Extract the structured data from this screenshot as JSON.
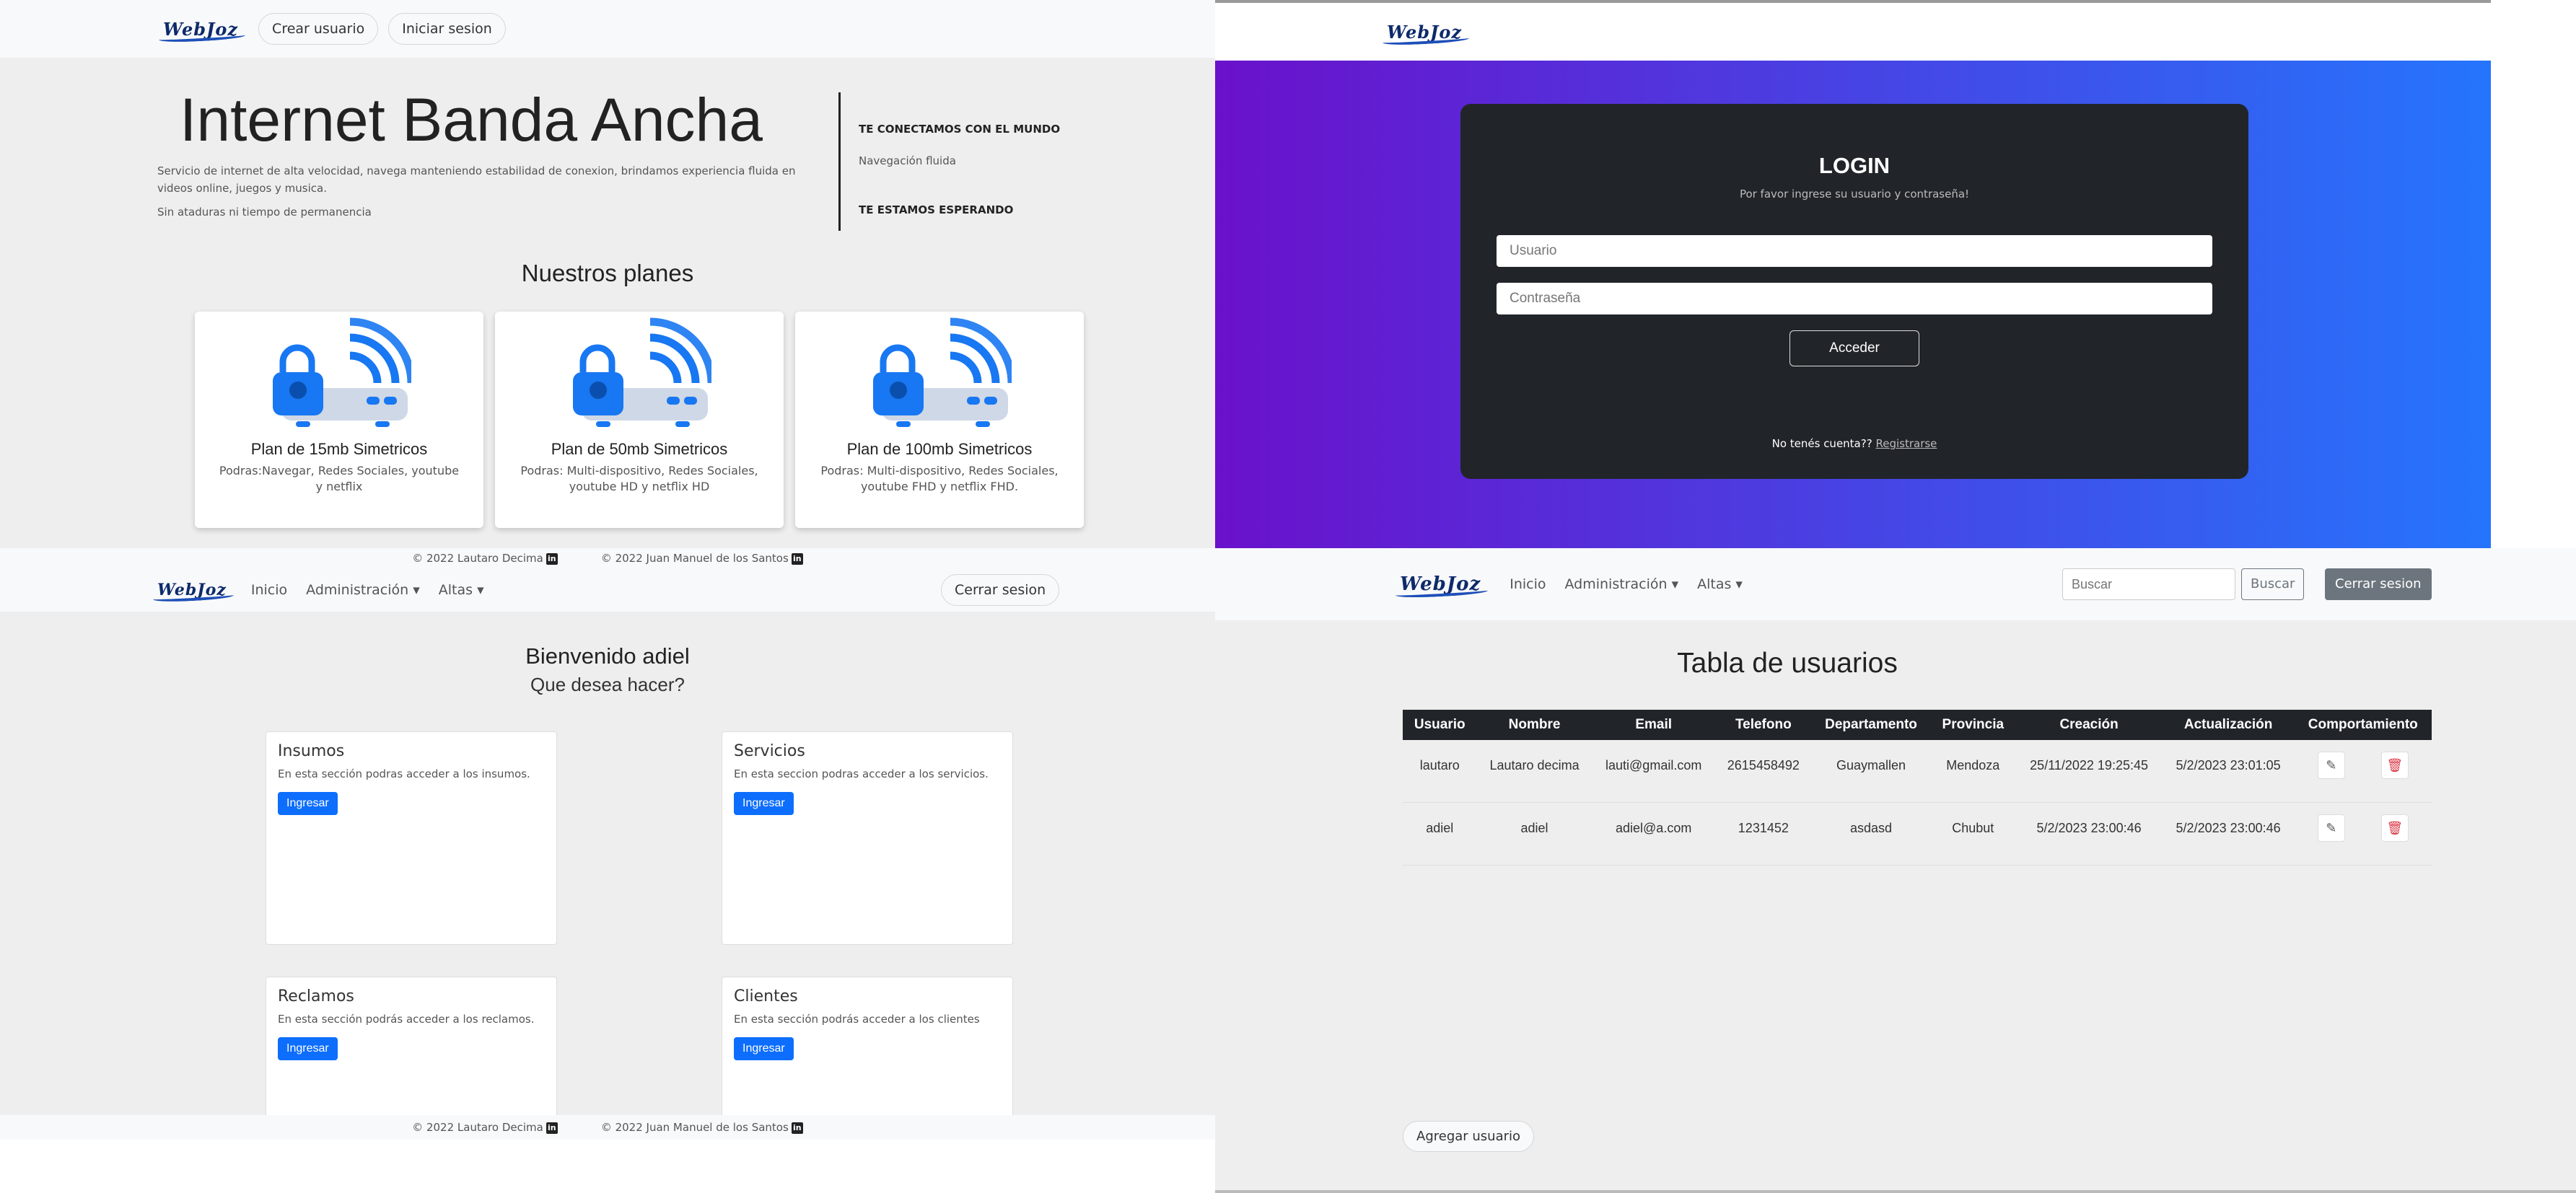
{
  "logo_text": "WebJoz",
  "home": {
    "nav": {
      "crear": "Crear usuario",
      "iniciar": "Iniciar sesion"
    },
    "hero_title": "Internet Banda Ancha",
    "hero_desc": "Servicio de internet de alta velocidad, navega manteniendo estabilidad de conexion, brindamos experiencia fluida en videos online, juegos y musica.",
    "hero_note": "Sin ataduras ni tiempo de permanencia",
    "side_1": "TE CONECTAMOS CON EL MUNDO",
    "side_2": "Navegación fluida",
    "side_3": "TE ESTAMOS ESPERANDO",
    "plans_title": "Nuestros planes",
    "plans": [
      {
        "title": "Plan de 15mb Simetricos",
        "desc": "Podras:Navegar, Redes Sociales, youtube y netflix"
      },
      {
        "title": "Plan de 50mb Simetricos",
        "desc": "Podras: Multi-dispositivo, Redes Sociales, youtube HD y netflix HD"
      },
      {
        "title": "Plan de 100mb Simetricos",
        "desc": "Podras: Multi-dispositivo, Redes Sociales, youtube FHD y netflix FHD."
      }
    ],
    "footer_1": "© 2022 Lautaro Decima",
    "footer_2": "© 2022 Juan Manuel de los Santos"
  },
  "login": {
    "title": "LOGIN",
    "subtitle": "Por favor ingrese su usuario y contraseña!",
    "user_ph": "Usuario",
    "pass_ph": "Contraseña",
    "submit": "Acceder",
    "no_account": "No tenés cuenta??",
    "register": "Registrarse",
    "gradient": [
      "#6a11cb",
      "#2575fc"
    ]
  },
  "dash": {
    "nav": {
      "inicio": "Inicio",
      "admin": "Administración",
      "altas": "Altas",
      "logout": "Cerrar sesion"
    },
    "welcome": "Bienvenido adiel",
    "question": "Que desea hacer?",
    "cards": [
      {
        "title": "Insumos",
        "desc": "En esta sección podras acceder a los insumos.",
        "btn": "Ingresar"
      },
      {
        "title": "Servicios",
        "desc": "En esta seccion podras acceder a los servicios.",
        "btn": "Ingresar"
      },
      {
        "title": "Reclamos",
        "desc": "En esta sección podrás acceder a los reclamos.",
        "btn": "Ingresar"
      },
      {
        "title": "Clientes",
        "desc": "En esta sección podrás acceder a los clientes",
        "btn": "Ingresar"
      }
    ],
    "footer_1": "© 2022 Lautaro Decima",
    "footer_2": "© 2022 Juan Manuel de los Santos"
  },
  "users": {
    "nav": {
      "inicio": "Inicio",
      "admin": "Administración",
      "altas": "Altas",
      "search_ph": "Buscar",
      "search_btn": "Buscar",
      "logout": "Cerrar sesion"
    },
    "title": "Tabla de usuarios",
    "headers": [
      "Usuario",
      "Nombre",
      "Email",
      "Telefono",
      "Departamento",
      "Provincia",
      "Creación",
      "Actualización",
      "Comportamiento"
    ],
    "rows": [
      [
        "lautaro",
        "Lautaro decima",
        "lauti@gmail.com",
        "2615458492",
        "Guaymallen",
        "Mendoza",
        "25/11/2022 19:25:45",
        "5/2/2023 23:01:05"
      ],
      [
        "adiel",
        "adiel",
        "adiel@a.com",
        "1231452",
        "asdasd",
        "Chubut",
        "5/2/2023 23:00:46",
        "5/2/2023 23:00:46"
      ]
    ],
    "add_btn": "Agregar usuario"
  }
}
